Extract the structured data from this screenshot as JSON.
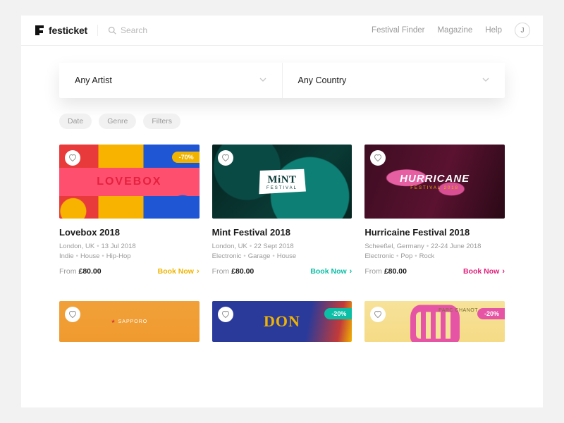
{
  "header": {
    "brand": "festicket",
    "search_placeholder": "Search",
    "nav": [
      "Festival Finder",
      "Magazine",
      "Help"
    ],
    "avatar_initial": "J"
  },
  "dropdowns": [
    {
      "label": "Any Artist"
    },
    {
      "label": "Any Country"
    }
  ],
  "chips": [
    "Date",
    "Genre",
    "Filters"
  ],
  "colors": {
    "book_yellow": "#f0b400",
    "book_teal": "#0bbfa6",
    "book_pink": "#e01f7a",
    "badge_yellow": "#f0b400",
    "badge_teal": "#0bbfa6",
    "badge_pink": "#e655a5"
  },
  "cards": [
    {
      "art": "lovebox",
      "art_label_main": "LOVEBOX",
      "badge": "-70%",
      "badge_color": "badge_yellow",
      "title": "Lovebox 2018",
      "location": "London, UK",
      "date": "13 Jul 2018",
      "tags": [
        "Indie",
        "House",
        "Hip-Hop"
      ],
      "price_from": "From",
      "price": "£80.00",
      "book_label": "Book Now",
      "book_color": "book_yellow"
    },
    {
      "art": "mint",
      "art_label_main": "MiNT",
      "art_label_sub": "FESTIVAL",
      "title": "Mint Festival 2018",
      "location": "London, UK",
      "date": "22 Sept 2018",
      "tags": [
        "Electronic",
        "Garage",
        "House"
      ],
      "price_from": "From",
      "price": "£80.00",
      "book_label": "Book Now",
      "book_color": "book_teal"
    },
    {
      "art": "hurricane",
      "art_label_main": "HURRICANE",
      "art_label_sub": "FESTIVAL 2018",
      "title": "Hurricaine Festival 2018",
      "location": "Scheeßel, Germany",
      "date": "22-24 June 2018",
      "tags": [
        "Electronic",
        "Pop",
        "Rock"
      ],
      "price_from": "From",
      "price": "£80.00",
      "book_label": "Book Now",
      "book_color": "book_pink"
    }
  ],
  "cards_row2": [
    {
      "art": "sapporo",
      "art_label_main": "SAPPORO"
    },
    {
      "art": "don",
      "art_label_main": "DON",
      "badge": "-20%",
      "badge_color": "badge_teal"
    },
    {
      "art": "parc",
      "art_label_main": "PARC CHANOT",
      "badge": "-20%",
      "badge_color": "badge_pink"
    }
  ]
}
